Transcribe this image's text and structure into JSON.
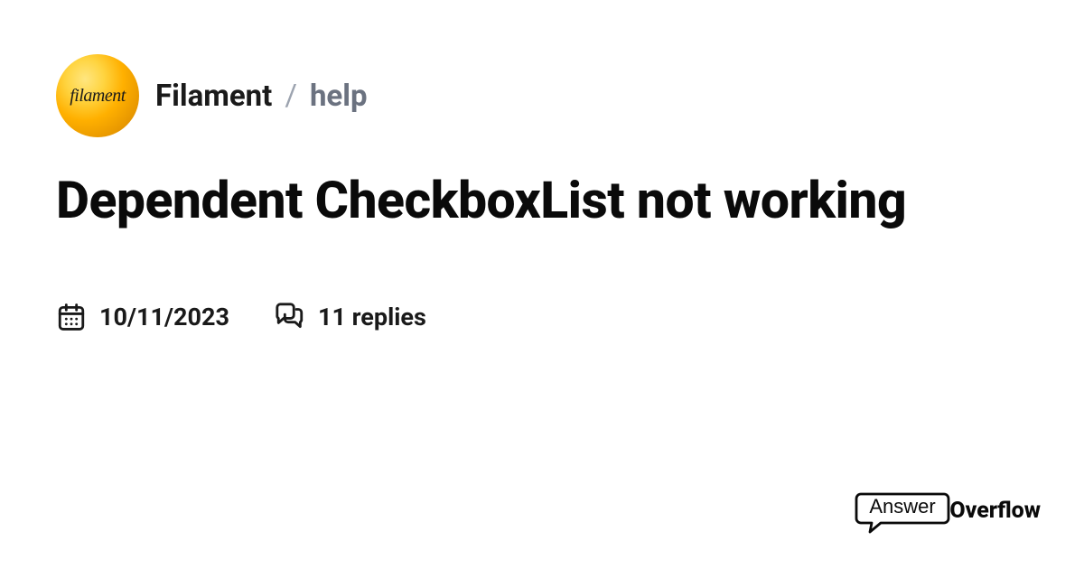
{
  "avatar": {
    "label": "filament"
  },
  "breadcrumb": {
    "community": "Filament",
    "separator": "/",
    "channel": "help"
  },
  "post": {
    "title": "Dependent CheckboxList not working",
    "date": "10/11/2023",
    "replies_text": "11 replies"
  },
  "footer": {
    "logo_part1": "Answer",
    "logo_part2": "Overflow"
  }
}
